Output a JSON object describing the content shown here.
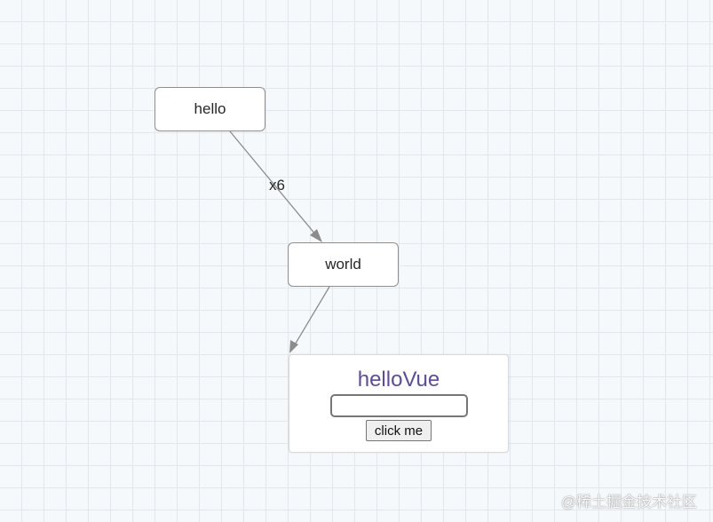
{
  "diagram": {
    "nodes": [
      {
        "id": "hello",
        "label": "hello"
      },
      {
        "id": "world",
        "label": "world"
      }
    ],
    "edges": [
      {
        "from": "hello",
        "to": "world",
        "label": "x6"
      },
      {
        "from": "world",
        "to": "vue-node",
        "label": ""
      }
    ],
    "vue_node": {
      "title": "helloVue",
      "input_value": "",
      "button_label": "click me"
    }
  },
  "colors": {
    "grid_background": "#f6f9fb",
    "grid_line": "#e2e7ec",
    "node_border": "#8f8f8f",
    "edge": "#8c8c8c",
    "vue_title": "#5e4b9c"
  },
  "watermark": "@稀土掘金技术社区"
}
